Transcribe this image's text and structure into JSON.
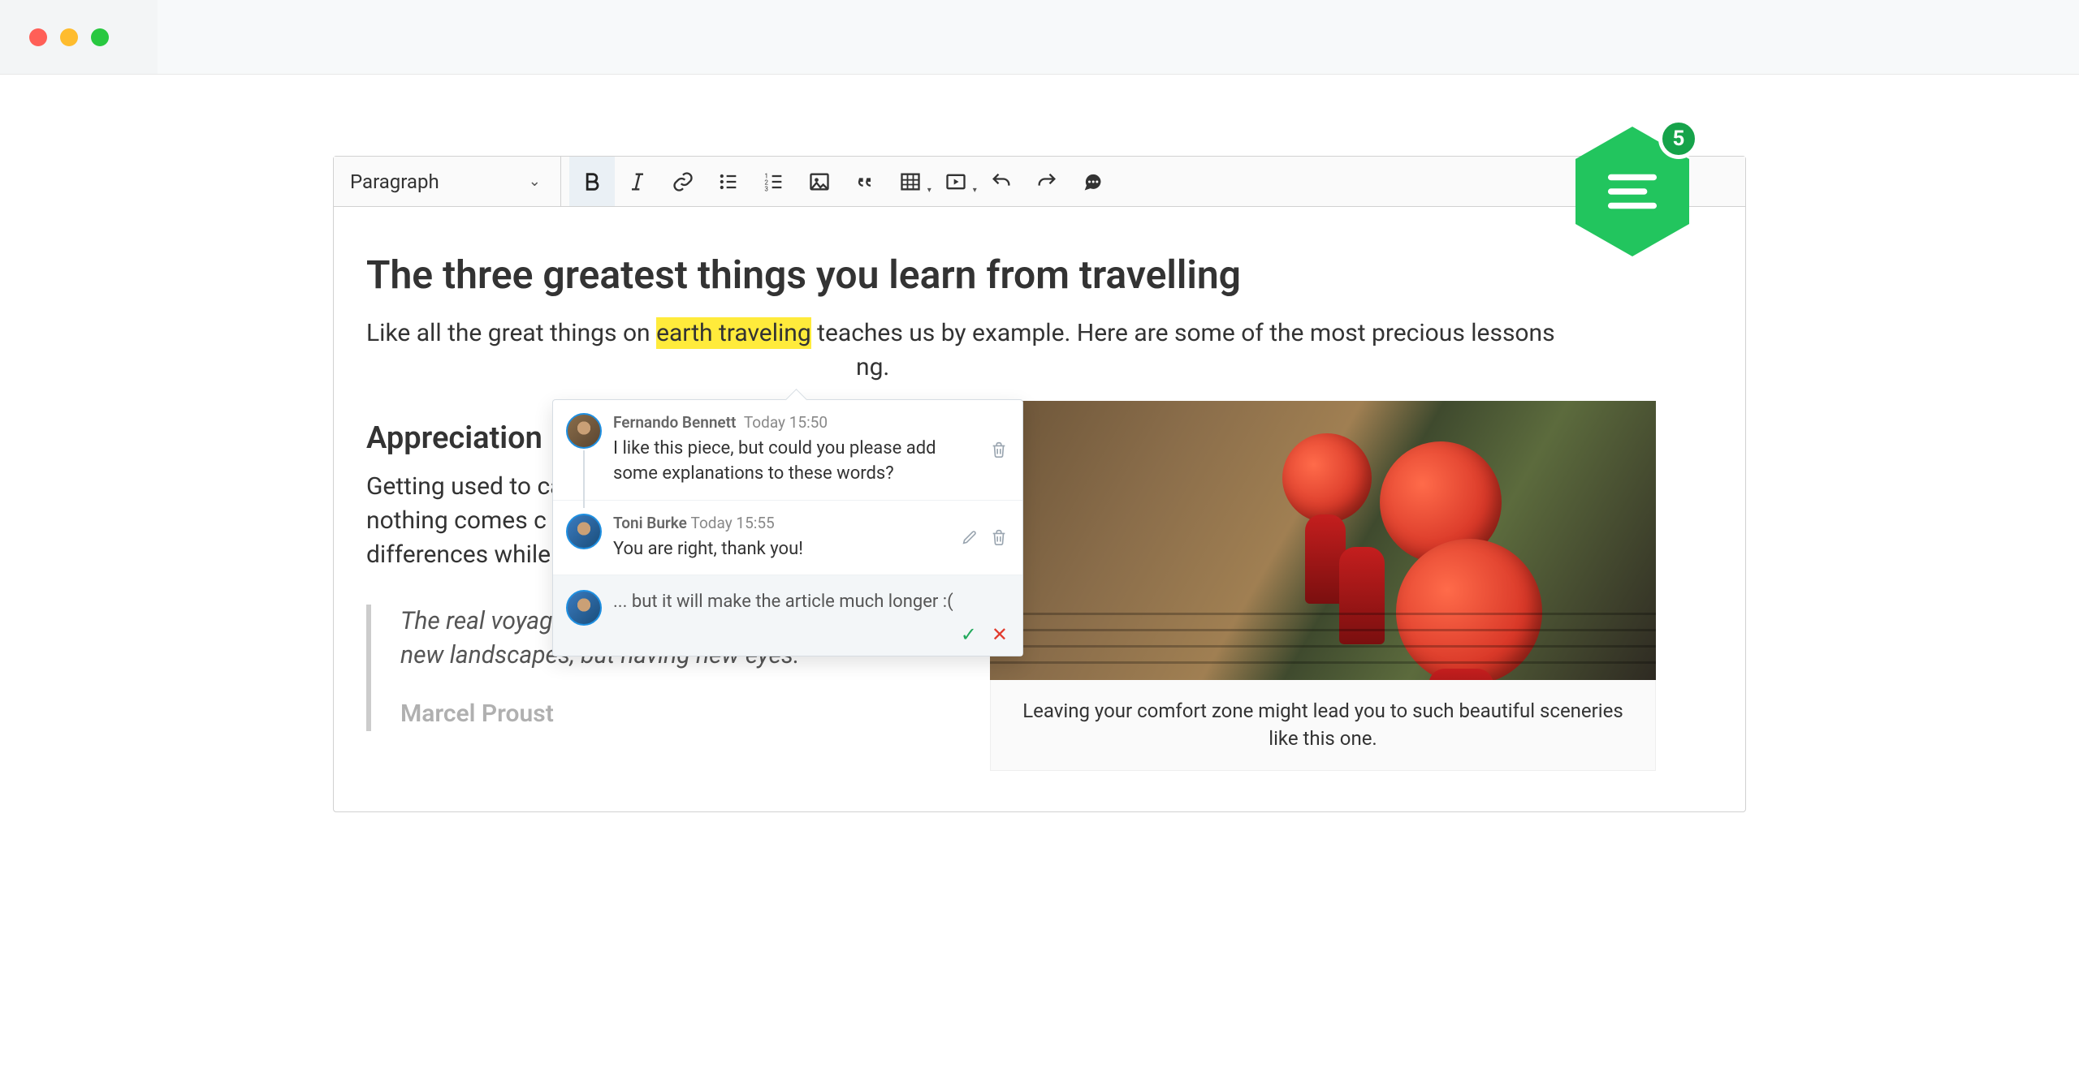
{
  "toolbar": {
    "heading_label": "Paragraph"
  },
  "badge": {
    "count": "5"
  },
  "doc": {
    "title": "The three greatest things you learn from travelling",
    "intro_before": "Like all the great things on ",
    "intro_highlight": "earth traveling",
    "intro_after": " teaches us by example. Here are some of the most precious lessons",
    "intro_tail": "ng.",
    "section1_title": "Appreciation",
    "section1_body": "Getting used to can be challeng learn about cult nothing comes c cultural diversity appreciate each differences while you become more culturally fluid.",
    "quote_text": "The real voyage of discovery consists not in seeking new landscapes, but having new eyes.",
    "quote_author": "Marcel Proust",
    "caption": "Leaving your comfort zone might lead you to such beautiful sceneries like this one."
  },
  "comments": [
    {
      "author": "Fernando Bennett",
      "time": "Today 15:50",
      "text": "I like this piece, but could you please add some explanations to these words?"
    },
    {
      "author": "Toni Burke",
      "time": "Today 15:55",
      "text": "You are right, thank you!"
    }
  ],
  "reply": {
    "text": "... but it will make the article much longer :("
  }
}
